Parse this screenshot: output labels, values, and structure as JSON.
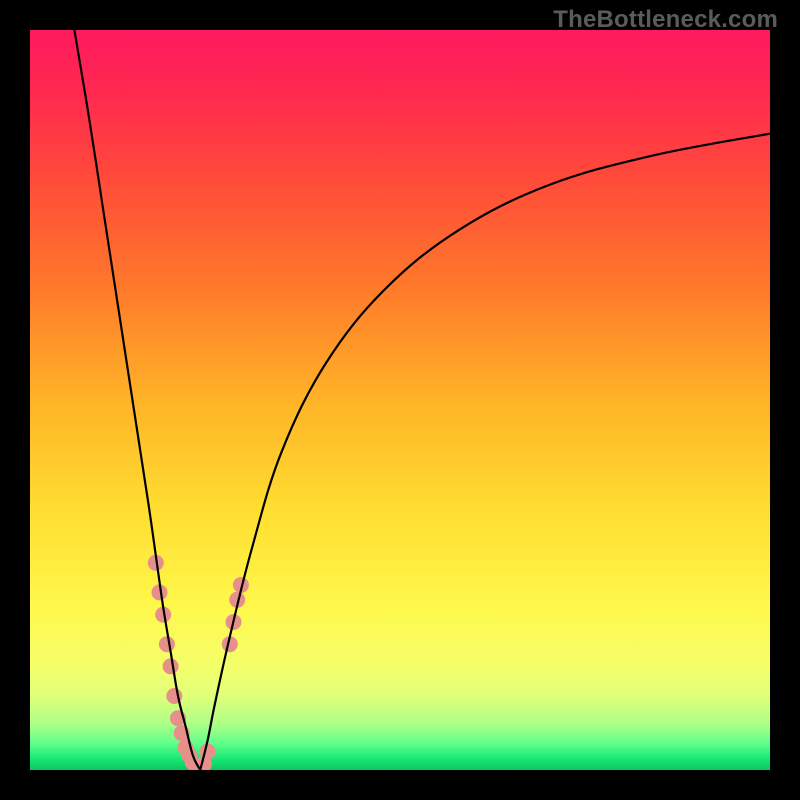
{
  "watermark": "TheBottleneck.com",
  "chart_data": {
    "type": "line",
    "title": "",
    "xlabel": "",
    "ylabel": "",
    "xlim": [
      0,
      100
    ],
    "ylim": [
      0,
      100
    ],
    "grid": false,
    "legend": false,
    "description": "Two black curves forming a V-shape on a vertical color gradient (green at bottom through yellow/orange to red/pink at top). Small salmon markers cluster near the bottom of the V.",
    "gradient_stops": [
      {
        "offset": 0.0,
        "color": "#ff1a5f"
      },
      {
        "offset": 0.08,
        "color": "#ff2850"
      },
      {
        "offset": 0.2,
        "color": "#ff4a3a"
      },
      {
        "offset": 0.35,
        "color": "#ff7a2a"
      },
      {
        "offset": 0.5,
        "color": "#ffb327"
      },
      {
        "offset": 0.65,
        "color": "#ffde30"
      },
      {
        "offset": 0.78,
        "color": "#fff84c"
      },
      {
        "offset": 0.86,
        "color": "#f4ff6a"
      },
      {
        "offset": 0.9,
        "color": "#e0ff7a"
      },
      {
        "offset": 0.94,
        "color": "#a8ff88"
      },
      {
        "offset": 0.965,
        "color": "#5cff8a"
      },
      {
        "offset": 0.985,
        "color": "#18e874"
      },
      {
        "offset": 1.0,
        "color": "#0cc662"
      }
    ],
    "series": [
      {
        "name": "left-curve",
        "x": [
          6,
          8,
          10,
          12,
          14,
          16,
          17,
          18,
          19,
          20,
          21,
          22,
          23
        ],
        "y": [
          100,
          88,
          75,
          62,
          49,
          36,
          29,
          22,
          16,
          10,
          6,
          2,
          0
        ]
      },
      {
        "name": "right-curve",
        "x": [
          23,
          24,
          25,
          27,
          30,
          34,
          40,
          48,
          58,
          70,
          84,
          100
        ],
        "y": [
          0,
          4,
          9,
          18,
          30,
          43,
          55,
          65,
          73,
          79,
          83,
          86
        ]
      }
    ],
    "markers": {
      "name": "salmon-dots",
      "color": "#e78f8a",
      "radius_px": 8,
      "points": [
        {
          "x": 17.0,
          "y": 28
        },
        {
          "x": 17.5,
          "y": 24
        },
        {
          "x": 18.0,
          "y": 21
        },
        {
          "x": 18.5,
          "y": 17
        },
        {
          "x": 19.0,
          "y": 14
        },
        {
          "x": 19.5,
          "y": 10
        },
        {
          "x": 20.0,
          "y": 7
        },
        {
          "x": 20.5,
          "y": 5
        },
        {
          "x": 21.0,
          "y": 3
        },
        {
          "x": 21.5,
          "y": 2
        },
        {
          "x": 22.0,
          "y": 1
        },
        {
          "x": 22.5,
          "y": 0.5
        },
        {
          "x": 23.0,
          "y": 0.2
        },
        {
          "x": 23.5,
          "y": 0.8
        },
        {
          "x": 24.0,
          "y": 2.5
        },
        {
          "x": 27.0,
          "y": 17
        },
        {
          "x": 27.5,
          "y": 20
        },
        {
          "x": 28.0,
          "y": 23
        },
        {
          "x": 28.5,
          "y": 25
        }
      ]
    }
  }
}
